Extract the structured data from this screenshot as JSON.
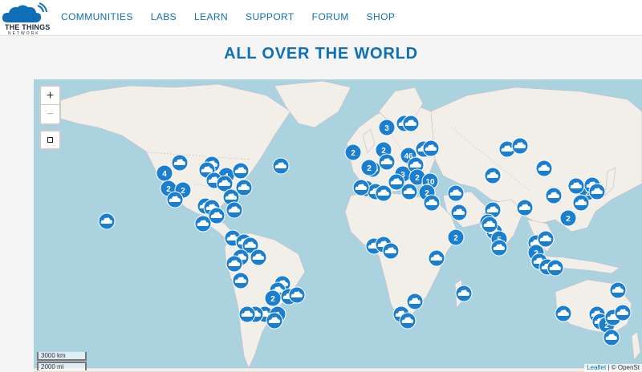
{
  "brand": {
    "name": "THE THINGS",
    "sub": "NETWORK"
  },
  "nav": {
    "items": [
      "COMMUNITIES",
      "LABS",
      "LEARN",
      "SUPPORT",
      "FORUM",
      "SHOP"
    ]
  },
  "heading": "ALL OVER THE WORLD",
  "map": {
    "zoom_in": "+",
    "zoom_out": "−",
    "scale_km": "3000 km",
    "scale_mi": "2000 mi",
    "attribution_leaflet": "Leaflet",
    "attribution_sep": " | © OpenSt",
    "marker_icon": "cloud-icon",
    "cluster_labels": [
      "2",
      "4",
      "2",
      "2",
      "4",
      "3",
      "2",
      "2",
      "3",
      "46",
      "2",
      "10",
      "2",
      "5",
      "2",
      "2",
      "2",
      "2",
      "2",
      "2",
      "2",
      "2",
      "2",
      "2",
      "2",
      "2"
    ]
  },
  "colors": {
    "accent": "#0e6fb8",
    "marker": "#1a7fd1",
    "water": "#aad3df",
    "land": "#f2efe9"
  }
}
